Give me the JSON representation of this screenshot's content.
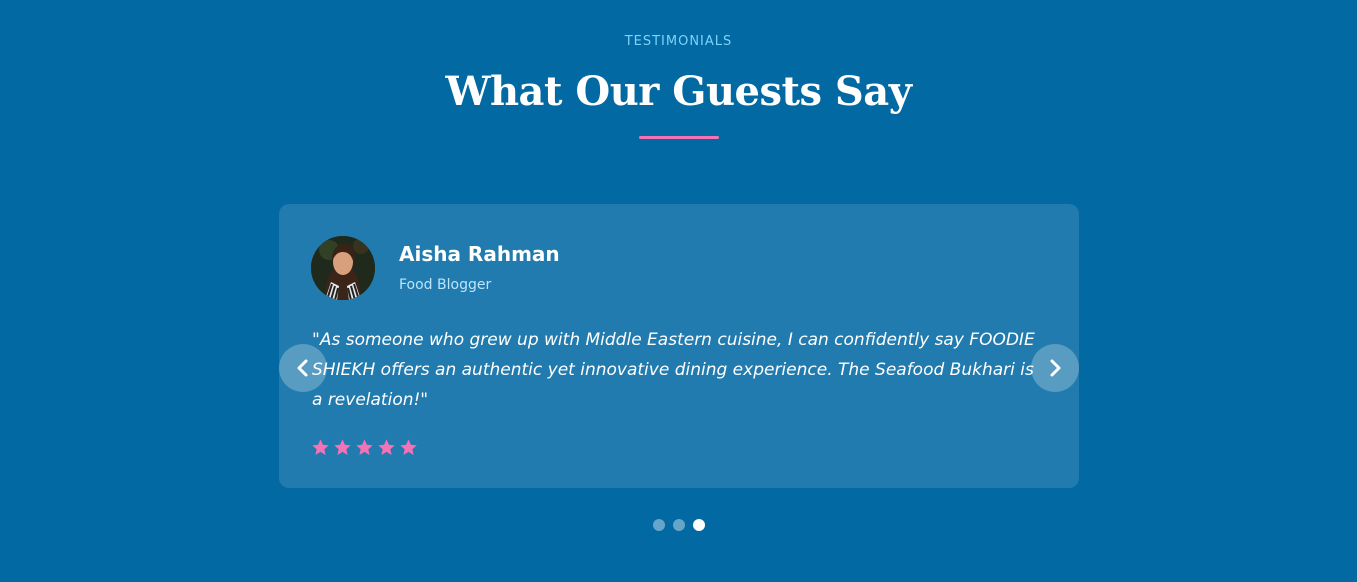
{
  "section": {
    "eyebrow": "TESTIMONIALS",
    "title": "What Our Guests Say",
    "accent_color": "#f472b6",
    "background_color": "#0369a3"
  },
  "testimonial": {
    "name": "Aisha Rahman",
    "role": "Food Blogger",
    "quote": "\"As someone who grew up with Middle Eastern cuisine, I can confidently say FOODIE SHIEKH offers an authentic yet innovative dining experience. The Seafood Bukhari is a revelation!\"",
    "rating": 5,
    "rating_max": 5,
    "star_color": "#f472b6",
    "avatar": "avatar-photo"
  },
  "carousel": {
    "prev_icon": "chevron-left-icon",
    "next_icon": "chevron-right-icon",
    "total_slides": 3,
    "active_slide": 3
  }
}
